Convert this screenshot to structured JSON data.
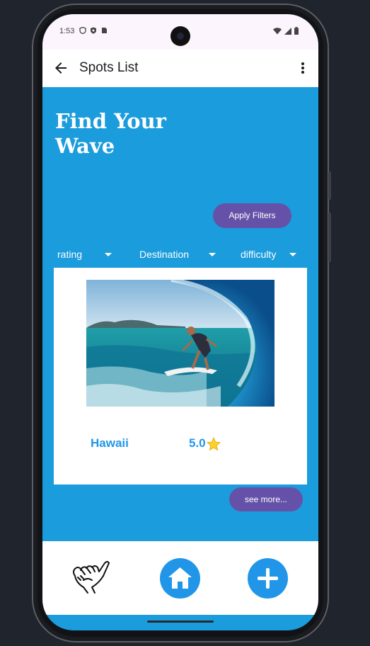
{
  "status_bar": {
    "time": "1:53",
    "left_icons": [
      "shield-icon",
      "vpn-icon",
      "sim-icon"
    ],
    "right_icons": [
      "wifi-icon",
      "signal-icon",
      "battery-icon"
    ]
  },
  "app_bar": {
    "title": "Spots List",
    "back_icon": "arrow-back-icon",
    "menu_icon": "more-vert-icon"
  },
  "hero": {
    "title_line1": "Find Your",
    "title_line2": "Wave"
  },
  "apply_filters_label": "Apply Filters",
  "filters": [
    {
      "label": "rating"
    },
    {
      "label": "Destination"
    },
    {
      "label": "difficulty"
    }
  ],
  "spot_card": {
    "location": "Hawaii",
    "rating": "5.0",
    "rating_icon": "star-icon"
  },
  "see_more_label": "see more...",
  "bottom_nav": {
    "items": [
      "shaka-icon",
      "home-icon",
      "add-icon"
    ]
  },
  "colors": {
    "primary_blue": "#1b9cdc",
    "accent_blue": "#2196e8",
    "purple_button": "#6552a8",
    "background": "#20242d"
  }
}
